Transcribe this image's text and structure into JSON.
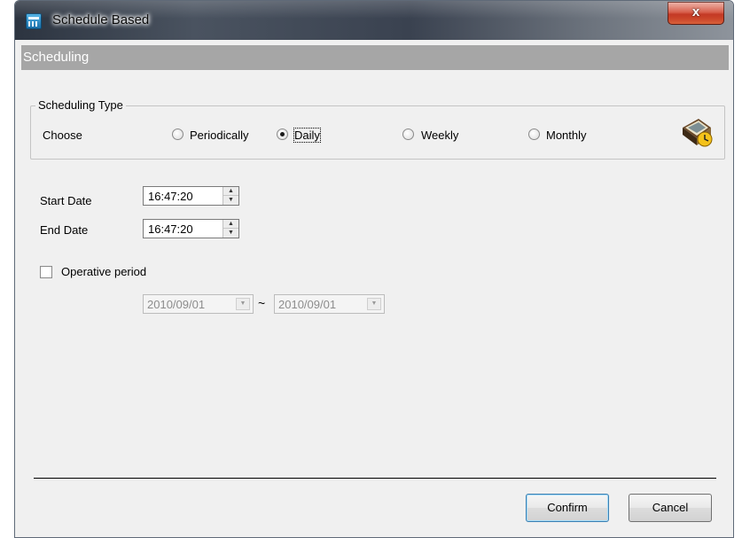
{
  "window": {
    "title": "Schedule Based",
    "close_label": "x"
  },
  "header": {
    "title": "Scheduling"
  },
  "scheduling_type": {
    "legend": "Scheduling Type",
    "choose_label": "Choose",
    "options": [
      "Periodically",
      "Daily",
      "Weekly",
      "Monthly"
    ],
    "selected": "Daily"
  },
  "start_date": {
    "label": "Start Date",
    "value": "16:47:20"
  },
  "end_date": {
    "label": "End Date",
    "value": "16:47:20"
  },
  "operative_period": {
    "label": "Operative period",
    "checked": false,
    "from": "2010/09/01",
    "separator": "~",
    "to": "2010/09/01"
  },
  "buttons": {
    "confirm": "Confirm",
    "cancel": "Cancel"
  },
  "icons": {
    "app": "calendar-app-icon",
    "schedule": "calendar-clock-icon",
    "spin_up": "spin-up-arrow-icon",
    "spin_down": "spin-down-arrow-icon",
    "dropdown": "dropdown-arrow-icon"
  }
}
